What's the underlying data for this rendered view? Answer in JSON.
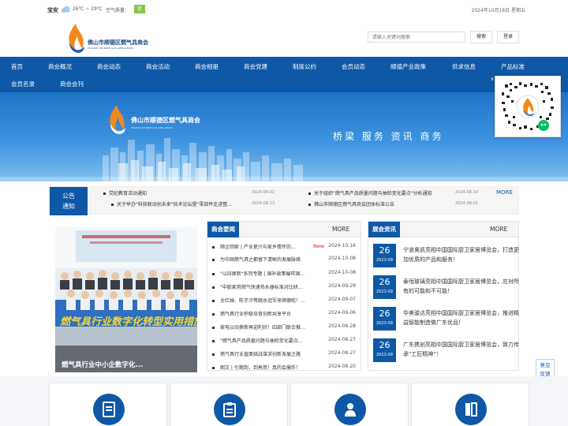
{
  "topbar": {
    "city": "宝安",
    "weather_icon": "cloud-icon",
    "temperature": "26℃ ~ 29℃",
    "air_quality_label": "空气质量：",
    "air_quality_value": "优",
    "date": "2024年10月18日 星期五"
  },
  "header": {
    "logo_name": "佛山市顺德区燃气具商会",
    "logo_sub": "FOSHAN SHUNDE GAS APPLIANCES",
    "search_placeholder": "请输入关键词搜索",
    "search_button": "搜索",
    "login_button": "登录"
  },
  "nav": {
    "items": [
      "首页",
      "商会概况",
      "商会动态",
      "商会活动",
      "商会相册",
      "商会党建",
      "制度公约",
      "会员动态",
      "顺德产业政策",
      "供求信息",
      "产品标准",
      "会员名录",
      "商会会刊"
    ],
    "chevron_icon": "chevron-right-icon"
  },
  "banner": {
    "logo_name": "佛山市顺德区燃气具商会",
    "logo_sub": "FOSHAN SHUNDE GAS APPLIANCES",
    "slogan": "桥梁 服务 资讯 商务"
  },
  "notice": {
    "label_line1": "公告",
    "label_line2": "通知",
    "more": "MORE",
    "items": [
      {
        "title": "党纪教育活动通知",
        "date": "2024-08-02"
      },
      {
        "title": "关于组织\"燃气具产品质量问题与抽检变化要点\"分析通知",
        "date": "2024-08-14"
      },
      {
        "title": "关于举办\"科技联动创未来\"技术论坛暨\"零部件走进整...",
        "date": "2024-08-13"
      },
      {
        "title": "佛山市顺德区燃气具商会团体标准公告",
        "date": "2024-08-01"
      }
    ]
  },
  "photo": {
    "caption": "燃气具行业中小企数字化..."
  },
  "news": {
    "title": "商会要闻",
    "more": "MORE",
    "new_badge": "New",
    "items": [
      {
        "title": "顺企回家 | 产业复兴与家乡情怀的...",
        "date": "2024-10-16",
        "is_new": true
      },
      {
        "title": "为中国燃气具之都留下清晰的发展脉络",
        "date": "2024-10-08"
      },
      {
        "title": "\"以旧换新\"系列专题 | 国补政策催旺国...",
        "date": "2024-10-08"
      },
      {
        "title": "\"中欧家用燃气快速热水器标准对比研...",
        "date": "2024-09-29"
      },
      {
        "title": "全红婵、陈芋汐等跳水冠军来顺德啦！...",
        "date": "2024-09-07"
      },
      {
        "title": "燃气具行业积极培育创新共享平台",
        "date": "2024-09-06"
      },
      {
        "title": "家电以旧换新再迎利好！四部门联合推...",
        "date": "2024-08-28"
      },
      {
        "title": "\"燃气具产品质量问题与抽检变化要点...",
        "date": "2024-08-27"
      },
      {
        "title": "燃气具行业直面挑战谋求创新发展之路",
        "date": "2024-08-27"
      },
      {
        "title": "图文 | 引期到，到再用！真的会爆炸！",
        "date": "2024-08-20"
      }
    ]
  },
  "exhibition": {
    "title": "展会资讯",
    "more": "MORE",
    "items": [
      {
        "day": "26",
        "month": "2023-09",
        "title": "宁波奥凯亮相中国国际厨卫家居博览会，打造更加优质的产品和服务！"
      },
      {
        "day": "26",
        "month": "2023-09",
        "title": "泰恒玻璃亮相中国国际厨卫家居博览会，应对所有的可能和不可能！"
      },
      {
        "day": "26",
        "month": "2023-09",
        "title": "华美骏达亮相中国国际厨卫家居博览会，推进精益智能制造做广东优品！"
      },
      {
        "day": "26",
        "month": "2023-09",
        "title": "广东携创亮相中国国际厨卫家居博览会，致力传承\"工匠精神\"！"
      }
    ]
  },
  "feedback": {
    "line1": "意见",
    "line2": "反馈"
  },
  "services": [
    {
      "icon": "document-icon"
    },
    {
      "icon": "clipboard-icon"
    },
    {
      "icon": "user-icon"
    },
    {
      "icon": "book-icon"
    }
  ],
  "colors": {
    "primary": "#0e58a6",
    "new_badge": "#e02020",
    "air_quality_good": "#8bc34a"
  }
}
